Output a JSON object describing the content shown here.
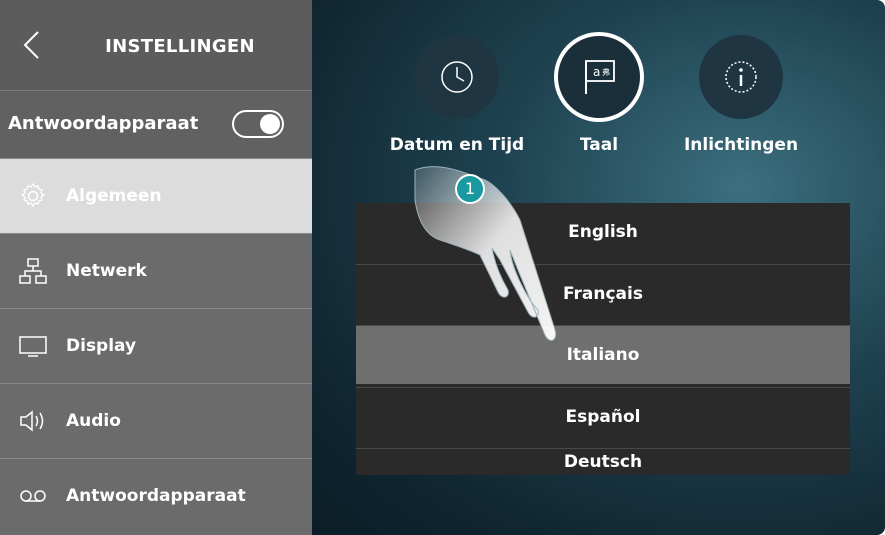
{
  "sidebar": {
    "title": "INSTELLINGEN",
    "toggle_label": "Antwoordapparaat",
    "toggle_on": true,
    "items": [
      {
        "label": "Algemeen",
        "icon": "gear-icon",
        "active": true
      },
      {
        "label": "Netwerk",
        "icon": "network-icon",
        "active": false
      },
      {
        "label": "Display",
        "icon": "display-icon",
        "active": false
      },
      {
        "label": "Audio",
        "icon": "speaker-icon",
        "active": false
      },
      {
        "label": "Antwoordapparaat",
        "icon": "voicemail-icon",
        "active": false
      }
    ]
  },
  "tabs": [
    {
      "label": "Datum en Tijd",
      "icon": "clock-icon"
    },
    {
      "label": "Taal",
      "icon": "language-flag-icon"
    },
    {
      "label": "Inlichtingen",
      "icon": "info-icon"
    }
  ],
  "languages": {
    "options": [
      "English",
      "Français",
      "Italiano",
      "Español",
      "Deutsch"
    ],
    "selected": "Italiano"
  },
  "callout": {
    "number": "1"
  },
  "colors": {
    "accent": "#1a9aa0",
    "sidebar": "#6b6b6b",
    "selected_row": "#6f6f6f"
  }
}
